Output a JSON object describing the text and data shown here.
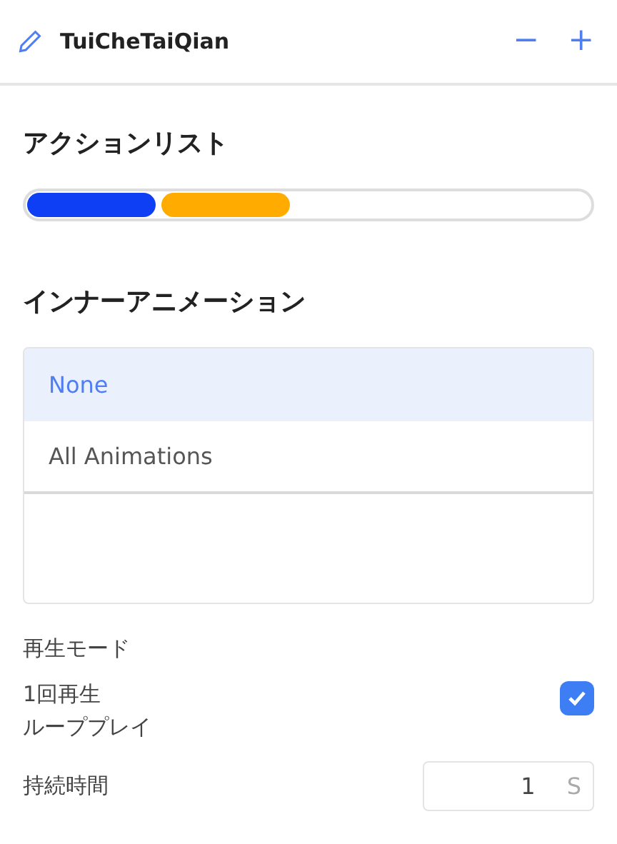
{
  "header": {
    "title": "TuiCheTaiQian",
    "buttons": [
      "−",
      "+"
    ]
  },
  "action_list": {
    "heading": "アクションリスト",
    "segments": [
      {
        "color": "#0f3ff5"
      },
      {
        "color": "#ffab00"
      }
    ]
  },
  "inner_animation": {
    "heading": "インナーアニメーション",
    "items": [
      {
        "label": "None",
        "selected": true
      },
      {
        "label": "All Animations",
        "selected": false
      }
    ]
  },
  "play_mode": {
    "label": "再生モード",
    "options": [
      "1回再生",
      "ループプレイ"
    ],
    "checked": true
  },
  "duration": {
    "label": "持続時間",
    "value": "1",
    "unit": "S"
  }
}
